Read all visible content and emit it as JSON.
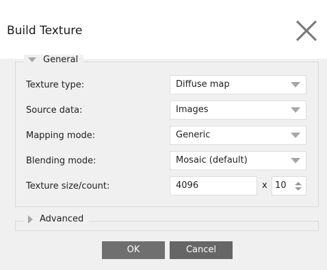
{
  "dialog": {
    "title": "Build Texture",
    "close_icon": "close-icon"
  },
  "general": {
    "label": "General",
    "expanded": true,
    "rows": [
      {
        "label": "Texture type:",
        "value": "Diffuse map"
      },
      {
        "label": "Source data:",
        "value": "Images"
      },
      {
        "label": "Mapping mode:",
        "value": "Generic"
      },
      {
        "label": "Blending mode:",
        "value": "Mosaic (default)"
      }
    ],
    "texture_size": {
      "label": "Texture size/count:",
      "size": "4096",
      "separator": "x",
      "count": "10"
    }
  },
  "advanced": {
    "label": "Advanced",
    "expanded": false
  },
  "buttons": {
    "ok": "OK",
    "cancel": "Cancel"
  },
  "colors": {
    "background": "#f0f0f0",
    "button": "#6f6f6f",
    "arrow": "#a6a6a6"
  }
}
